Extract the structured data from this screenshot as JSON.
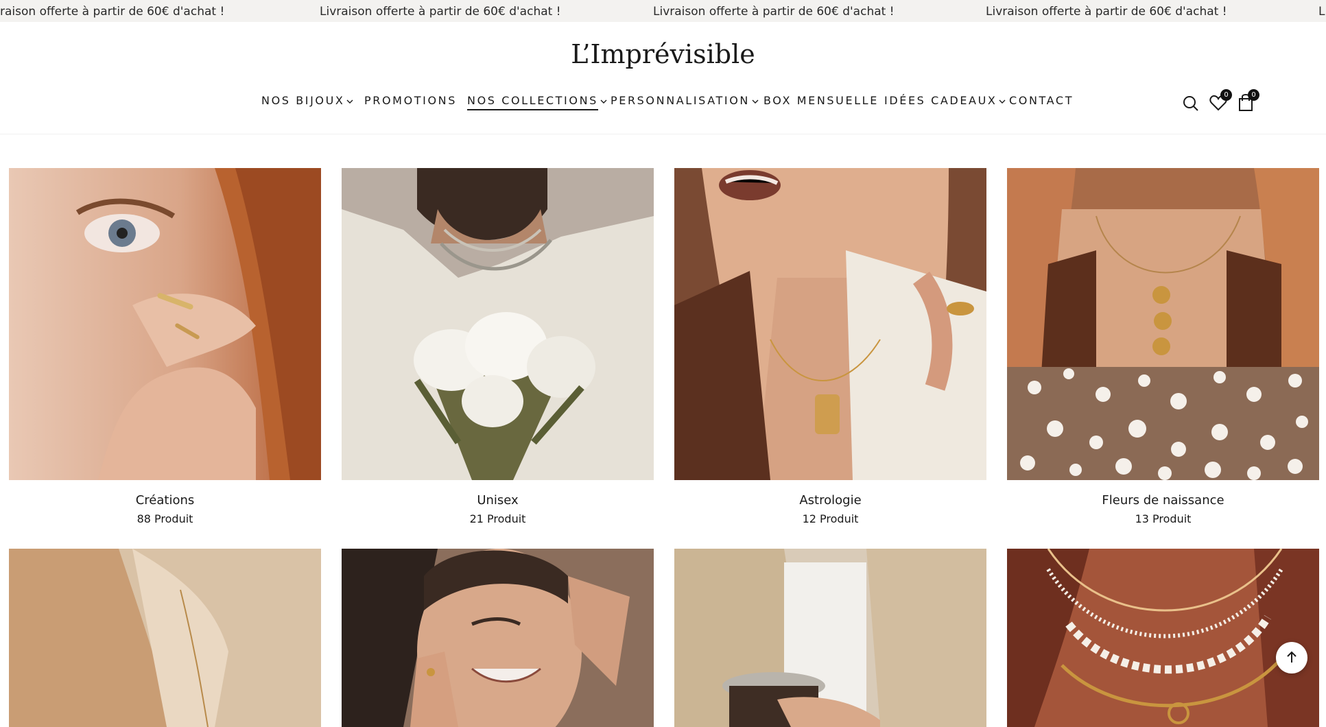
{
  "announcement": {
    "messages": [
      "raison offerte à partir de 60€ d'achat !",
      "Livraison offerte à partir de 60€ d'achat !",
      "Livraison offerte à partir de 60€ d'achat !",
      "Livraison offerte à partir de 60€ d'achat !",
      "L"
    ]
  },
  "header": {
    "logo": "L’Imprévisible",
    "nav": [
      {
        "label": "NOS BIJOUX",
        "dropdown": true
      },
      {
        "label": "PROMOTIONS",
        "dropdown": false
      },
      {
        "label": "NOS COLLECTIONS",
        "dropdown": true,
        "active": true
      },
      {
        "label": "PERSONNALISATION",
        "dropdown": true
      },
      {
        "label": "BOX MENSUELLE",
        "dropdown": false
      },
      {
        "label": "IDÉES CADEAUX",
        "dropdown": true
      },
      {
        "label": "CONTACT",
        "dropdown": false
      }
    ],
    "icons": {
      "search": "search-icon",
      "wishlist": "heart-icon",
      "wishlist_count": "0",
      "cart": "shopping-bag-icon",
      "cart_count": "0"
    }
  },
  "collections": [
    {
      "title": "Créations",
      "count": "88 Produit"
    },
    {
      "title": "Unisex",
      "count": "21 Produit"
    },
    {
      "title": "Astrologie",
      "count": "12 Produit"
    },
    {
      "title": "Fleurs de naissance",
      "count": "13 Produit"
    }
  ],
  "colors": {
    "announcement_bg": "#f3f2f0",
    "text": "#1a1a1a",
    "badge": "#111111"
  },
  "scroll_top": {
    "icon": "arrow-up-icon"
  }
}
